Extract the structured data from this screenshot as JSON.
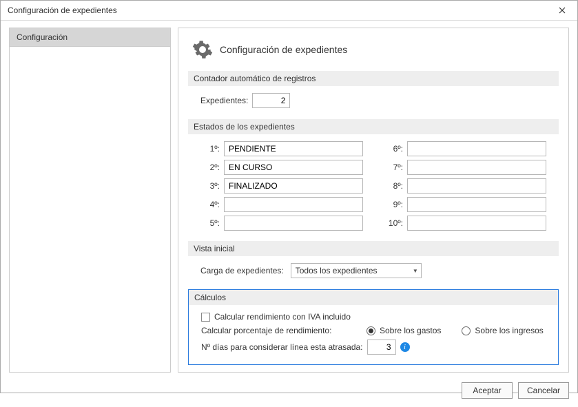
{
  "window": {
    "title": "Configuración de expedientes"
  },
  "sidebar": {
    "items": [
      {
        "label": "Configuración"
      }
    ]
  },
  "main": {
    "header_title": "Configuración de expedientes",
    "counter": {
      "section_label": "Contador automático de registros",
      "expedientes_label": "Expedientes:",
      "expedientes_value": "2"
    },
    "states": {
      "section_label": "Estados de los expedientes",
      "left": [
        {
          "label": "1º:",
          "value": "PENDIENTE"
        },
        {
          "label": "2º:",
          "value": "EN CURSO"
        },
        {
          "label": "3º:",
          "value": "FINALIZADO"
        },
        {
          "label": "4º:",
          "value": ""
        },
        {
          "label": "5º:",
          "value": ""
        }
      ],
      "right": [
        {
          "label": "6º:",
          "value": ""
        },
        {
          "label": "7º:",
          "value": ""
        },
        {
          "label": "8º:",
          "value": ""
        },
        {
          "label": "9º:",
          "value": ""
        },
        {
          "label": "10º:",
          "value": ""
        }
      ]
    },
    "view": {
      "section_label": "Vista inicial",
      "carga_label": "Carga de expedientes:",
      "carga_value": "Todos los expedientes"
    },
    "calc": {
      "section_label": "Cálculos",
      "iva_label": "Calcular rendimiento con IVA incluido",
      "pct_label": "Calcular porcentaje de rendimiento:",
      "radio_gastos": "Sobre los gastos",
      "radio_ingresos": "Sobre los ingresos",
      "days_label": "Nº días para considerar línea esta atrasada:",
      "days_value": "3"
    }
  },
  "footer": {
    "accept": "Aceptar",
    "cancel": "Cancelar"
  }
}
